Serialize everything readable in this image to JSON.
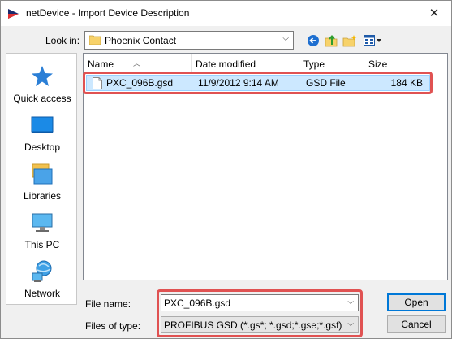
{
  "window": {
    "title": "netDevice - Import Device Description",
    "close_glyph": "✕"
  },
  "lookin": {
    "label": "Look in:",
    "value": "Phoenix Contact"
  },
  "toolbar": {
    "icons": [
      "back-icon",
      "up-folder-icon",
      "new-folder-icon",
      "view-menu-icon"
    ]
  },
  "places": [
    {
      "label": "Quick access",
      "icon": "star-icon"
    },
    {
      "label": "Desktop",
      "icon": "desktop-icon"
    },
    {
      "label": "Libraries",
      "icon": "libraries-icon"
    },
    {
      "label": "This PC",
      "icon": "computer-icon"
    },
    {
      "label": "Network",
      "icon": "network-icon"
    }
  ],
  "filelist": {
    "columns": [
      "Name",
      "Date modified",
      "Type",
      "Size"
    ],
    "rows": [
      {
        "name": "PXC_096B.gsd",
        "modified": "11/9/2012 9:14 AM",
        "type": "GSD File",
        "size": "184 KB"
      }
    ]
  },
  "filename": {
    "label": "File name:",
    "value": "PXC_096B.gsd"
  },
  "filetype": {
    "label": "Files of type:",
    "value": "PROFIBUS GSD (*.gs*; *.gsd;*.gse;*.gsf)"
  },
  "buttons": {
    "open": "Open",
    "cancel": "Cancel"
  },
  "colors": {
    "selection": "#cce8ff",
    "annotation": "#e05252",
    "accent": "#0078d7"
  }
}
